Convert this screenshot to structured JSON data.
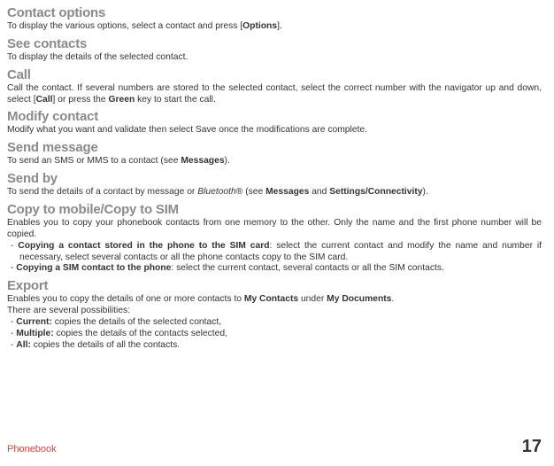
{
  "sections": {
    "contact_options": {
      "heading": "Contact options",
      "body_pre": "To display the various options, select a contact and press [",
      "bold": "Options",
      "body_post": "]."
    },
    "see_contacts": {
      "heading": "See contacts",
      "body": "To display the details of the selected contact."
    },
    "call": {
      "heading": "Call",
      "pre1": "Call the contact. If several numbers are stored to the selected contact, select the correct number with the navigator up and down, select [",
      "b1": "Call",
      "mid1": "] or press the ",
      "b2": "Green",
      "post1": " key to start the call."
    },
    "modify": {
      "heading": "Modify contact",
      "body": "Modify what you want and validate then select Save once the modifications are complete."
    },
    "send_msg": {
      "heading": "Send message",
      "pre": "To send an SMS or MMS to a contact (see ",
      "b": "Messages",
      "post": ")."
    },
    "send_by": {
      "heading": "Send by",
      "pre": "To send the details of a contact by message or ",
      "it": "Bluetooth",
      "reg": "®",
      "mid": " (see ",
      "b1": "Messages",
      "and": " and ",
      "b2": "Settings/Connectivity",
      "post": ")."
    },
    "copy": {
      "heading": "Copy to mobile/Copy to SIM",
      "intro": "Enables you to copy your phonebook contacts from one memory to the other. Only the name and the first phone number will be copied.",
      "li1b": "Copying a contact stored in the phone to the SIM card",
      "li1r": ": select the current contact and modify the name and number if necessary, select several contacts  or all the phone contacts copy to the SIM card.",
      "li2b": "Copying a SIM contact to the phone",
      "li2r": ": select the current contact, several contacts or all the SIM contacts."
    },
    "export": {
      "heading": "Export",
      "intro_pre": "Enables you to copy the details of one or more contacts to ",
      "b1": "My Contacts",
      "intro_mid": " under ",
      "b2": "My Documents",
      "intro_post": ".",
      "line2": "There are several possibilities:",
      "li1b": "Current:",
      "li1r": " copies the details of the selected contact,",
      "li2b": "Multiple:",
      "li2r": " copies the details of the contacts selected,",
      "li3b": "All:",
      "li3r": " copies the details of all the contacts."
    }
  },
  "footer": {
    "title": "Phonebook",
    "page": "17"
  }
}
